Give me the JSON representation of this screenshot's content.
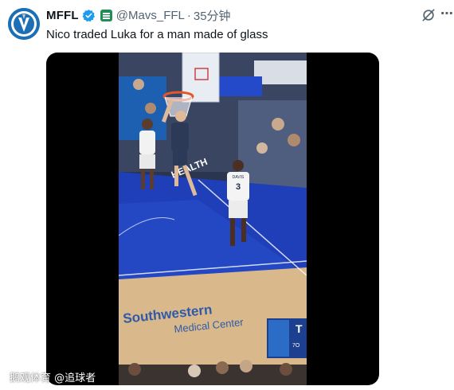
{
  "author": {
    "name": "MFFL",
    "handle": "@Mavs_FFL",
    "time_ago": "35分钟",
    "separator": "·"
  },
  "tweet": {
    "text": "Nico traded Luka for a man made of glass"
  },
  "video": {
    "court_sign_1": "Southwestern",
    "court_sign_2": "Medical Center",
    "baseline_sign": "HEALTH",
    "player_number": "3",
    "player_name": "DAVIS",
    "scoreboard": "T",
    "scoreboard_sub": "7O"
  },
  "watermark": "鹅观体育 @追球者",
  "icons": {
    "verified": "verified-badge-icon",
    "affiliate": "affiliate-badge-icon",
    "grok": "grok-icon",
    "more": "more-options-icon"
  },
  "colors": {
    "verified_blue": "#1d9bf0",
    "affiliate_green": "#1f8d55",
    "court_blue": "#1f3fb8",
    "court_wood": "#d9b98c"
  }
}
